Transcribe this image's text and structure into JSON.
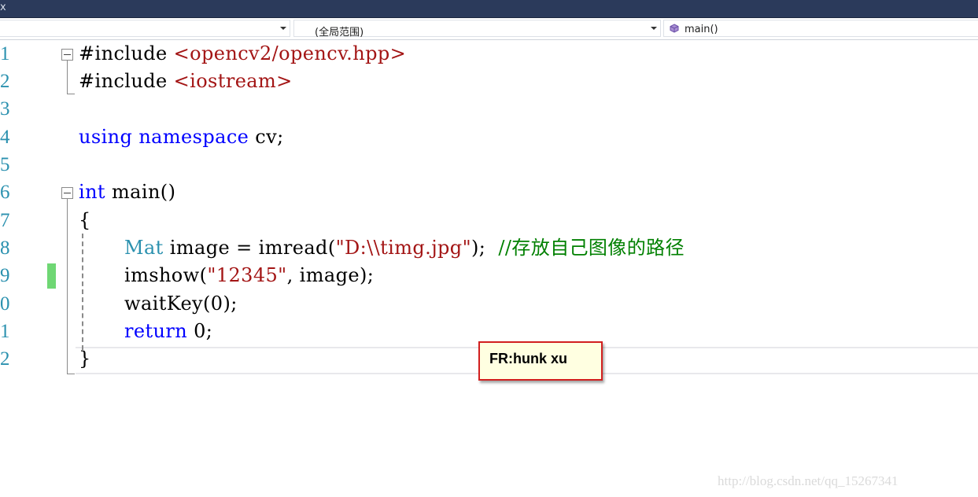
{
  "titlebar": {
    "close_glyph": "x"
  },
  "navbar": {
    "left_combo_value": "",
    "scope_combo_value": "(全局范围)",
    "function_combo_value": "main()",
    "function_icon": "cube-icon"
  },
  "editor": {
    "line_numbers": [
      "1",
      "2",
      "3",
      "4",
      "5",
      "6",
      "7",
      "8",
      "9",
      "0",
      "1",
      "2"
    ],
    "tokens": {
      "l1_directive": "#include ",
      "l1_header": "<opencv2/opencv.hpp>",
      "l2_directive": "#include ",
      "l2_header": "<iostream>",
      "l4_using": "using",
      "l4_namespace": "namespace",
      "l4_rest": " cv;",
      "l6_int": "int",
      "l6_rest": " main()",
      "l7_brace": "{",
      "l8_type": "Mat",
      "l8_mid": " image = imread(",
      "l8_string": "\"D:\\\\timg.jpg\"",
      "l8_end": ");  ",
      "l8_comment": "//存放自己图像的路径",
      "l9_start": "imshow(",
      "l9_string": "\"12345\"",
      "l9_end": ", image);",
      "l10": "waitKey(0);",
      "l11_return": "return",
      "l11_rest": " 0;",
      "l12_brace": "}"
    }
  },
  "tooltip": {
    "text": "FR:hunk xu"
  },
  "watermark": {
    "text": "http://blog.csdn.net/qq_15267341"
  },
  "colors": {
    "keyword": "#0000ff",
    "type": "#2b91af",
    "string": "#a31515",
    "comment": "#008000",
    "change_bar": "#6fd774",
    "titlebar": "#2b3a5b"
  }
}
